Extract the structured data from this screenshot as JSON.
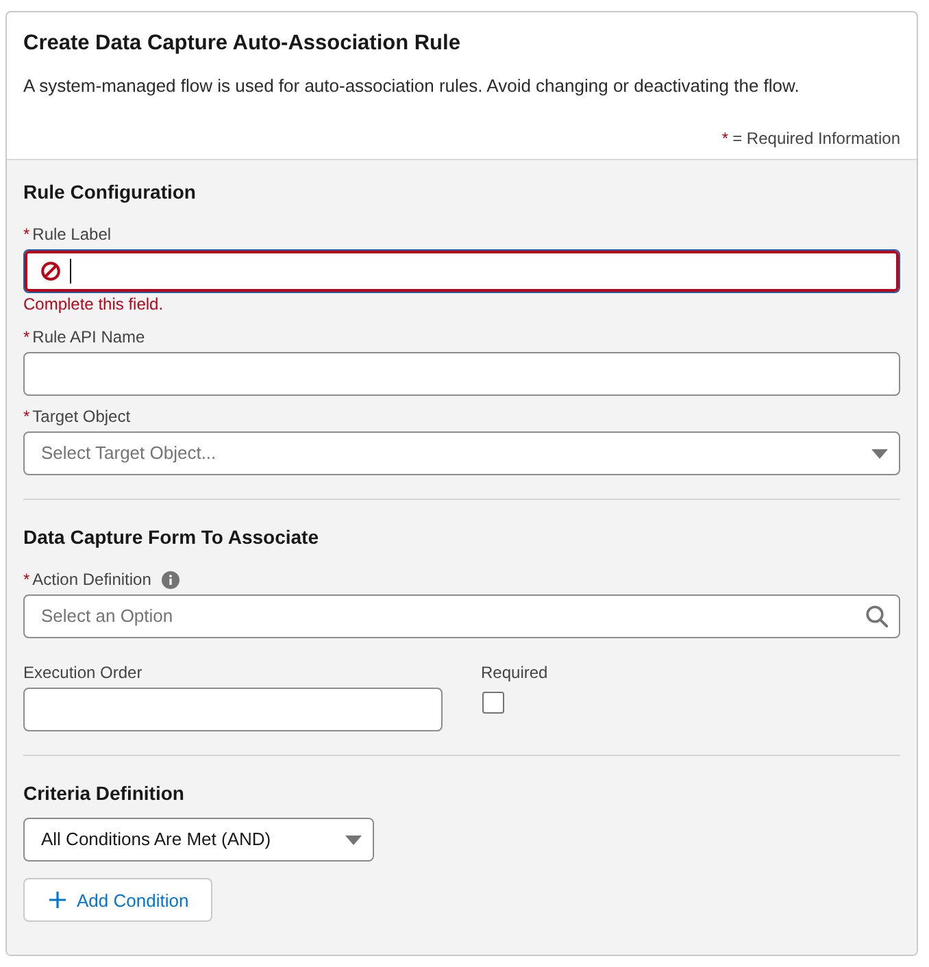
{
  "header": {
    "title": "Create Data Capture Auto-Association Rule",
    "description": "A system-managed flow is used for auto-association rules. Avoid changing or deactivating the flow.",
    "required_legend": {
      "mark": "*",
      "text": "= Required Information"
    }
  },
  "sections": [
    {
      "heading": "Rule Configuration",
      "rows": [
        [
          {
            "kind": "text",
            "required_mark": "*",
            "label": "Rule Label",
            "help": false,
            "focused": true,
            "error": "Complete this field."
          }
        ],
        [
          {
            "kind": "text",
            "required_mark": "*",
            "label": "Rule API Name",
            "help": false,
            "focused": false
          }
        ],
        [
          {
            "kind": "combobox",
            "required_mark": "*",
            "label": "Target Object",
            "help": false,
            "focused": false,
            "placeholder": "Select Target Object..."
          }
        ]
      ]
    },
    {
      "heading": "Data Capture Form To Associate",
      "rows": [
        [
          {
            "kind": "lookup",
            "required_mark": "*",
            "label": "Action Definition",
            "help": true,
            "focused": false,
            "placeholder": "Select an Option"
          }
        ],
        [
          {
            "kind": "text",
            "label": "Execution Order",
            "help": false,
            "focused": false
          },
          {
            "kind": "checkbox",
            "label": "Required",
            "help": false,
            "checked": false
          }
        ]
      ]
    },
    {
      "heading": "Criteria Definition",
      "rows": [
        [
          {
            "kind": "picklist",
            "focused": false,
            "value": "All Conditions Are Met (AND)"
          }
        ]
      ],
      "buttons": [
        {
          "label": "Add Condition"
        }
      ]
    }
  ]
}
